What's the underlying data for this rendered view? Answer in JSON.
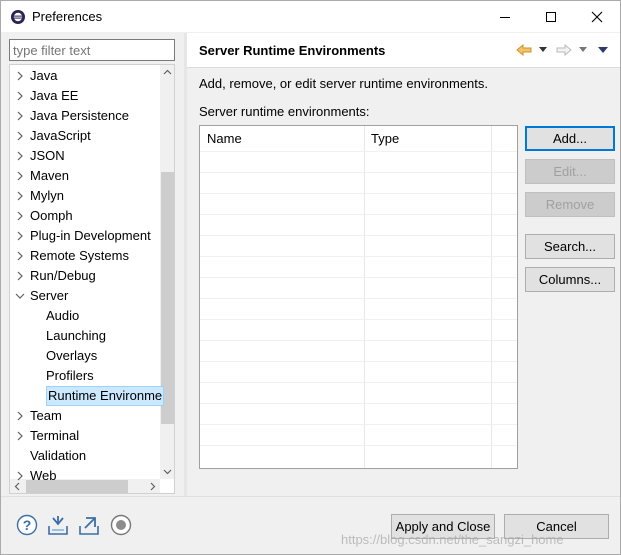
{
  "window": {
    "title": "Preferences"
  },
  "filter": {
    "placeholder": "type filter text"
  },
  "tree": {
    "items": [
      {
        "label": "Java",
        "expanded": false,
        "level": 0
      },
      {
        "label": "Java EE",
        "expanded": false,
        "level": 0
      },
      {
        "label": "Java Persistence",
        "expanded": false,
        "level": 0
      },
      {
        "label": "JavaScript",
        "expanded": false,
        "level": 0
      },
      {
        "label": "JSON",
        "expanded": false,
        "level": 0
      },
      {
        "label": "Maven",
        "expanded": false,
        "level": 0
      },
      {
        "label": "Mylyn",
        "expanded": false,
        "level": 0
      },
      {
        "label": "Oomph",
        "expanded": false,
        "level": 0
      },
      {
        "label": "Plug-in Development",
        "expanded": false,
        "level": 0
      },
      {
        "label": "Remote Systems",
        "expanded": false,
        "level": 0
      },
      {
        "label": "Run/Debug",
        "expanded": false,
        "level": 0
      },
      {
        "label": "Server",
        "expanded": true,
        "level": 0
      },
      {
        "label": "Audio",
        "level": 1
      },
      {
        "label": "Launching",
        "level": 1
      },
      {
        "label": "Overlays",
        "level": 1
      },
      {
        "label": "Profilers",
        "level": 1
      },
      {
        "label": "Runtime Environme",
        "level": 1,
        "selected": true
      },
      {
        "label": "Team",
        "expanded": false,
        "level": 0
      },
      {
        "label": "Terminal",
        "expanded": false,
        "level": 0
      },
      {
        "label": "Validation",
        "level": 0
      },
      {
        "label": "Web",
        "expanded": false,
        "level": 0
      }
    ]
  },
  "page": {
    "title": "Server Runtime Environments",
    "description": "Add, remove, or edit server runtime environments.",
    "list_label": "Server runtime environments:"
  },
  "table": {
    "columns": [
      "Name",
      "Type"
    ],
    "rows": []
  },
  "buttons": {
    "add": "Add...",
    "edit": "Edit...",
    "remove": "Remove",
    "search": "Search...",
    "columns": "Columns..."
  },
  "footer": {
    "apply_close": "Apply and Close",
    "cancel": "Cancel"
  },
  "watermark": "https://blog.csdn.net/the_sangzi_home",
  "colors": {
    "selection": "#cce8ff",
    "default_button_border": "#0078d7",
    "nav_arrow": "#e8a33a"
  }
}
